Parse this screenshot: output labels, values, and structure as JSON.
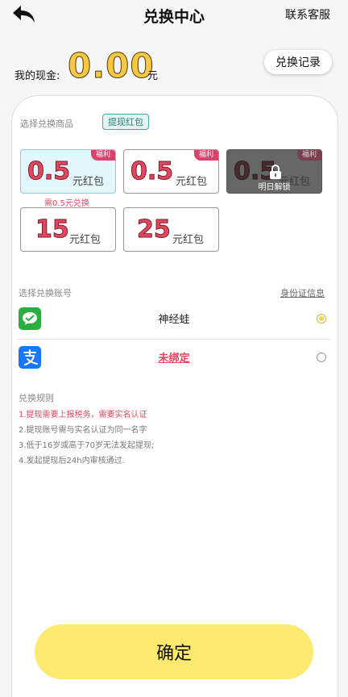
{
  "header": {
    "title": "兑换中心",
    "support_label": "联系客服"
  },
  "cash": {
    "label": "我的现金:",
    "amount": "0.00",
    "unit": "元",
    "record_button": "兑换记录"
  },
  "products": {
    "section_label": "选择兑换商品",
    "tag": "提现红包",
    "cards": [
      {
        "value": "0.5",
        "unit": "元红包",
        "badge": "福利",
        "note": "需0.5元兑换",
        "state": "selected"
      },
      {
        "value": "0.5",
        "unit": "元红包",
        "badge": "福利",
        "state": "normal"
      },
      {
        "value": "0.5",
        "unit": "元红包",
        "badge": "福利",
        "state": "locked",
        "lock_text": "明日解锁"
      },
      {
        "value": "15",
        "unit": "元红包",
        "state": "normal"
      },
      {
        "value": "25",
        "unit": "元红包",
        "state": "normal"
      }
    ]
  },
  "accounts": {
    "section_label": "选择兑换账号",
    "id_link": "身份证信息",
    "items": [
      {
        "icon": "wechat-icon",
        "name": "神经蛙",
        "selected": true,
        "color": "#2aae3f"
      },
      {
        "icon": "alipay-icon",
        "name": "未绑定",
        "selected": false,
        "color": "#1677ff"
      }
    ]
  },
  "rules": {
    "title": "兑换规则",
    "items": [
      "1.提现需要上报税务，需要实名认证",
      "2.提现账号需与实名认证为同一名字",
      "3.低于16岁或高于70岁无法发起提现;",
      "4.发起提现后24h内审核通过."
    ]
  },
  "confirm_label": "确定",
  "colors": {
    "accent_yellow": "#fbea6e",
    "value_red": "#e3475f",
    "badge_pink": "#d9436b"
  }
}
